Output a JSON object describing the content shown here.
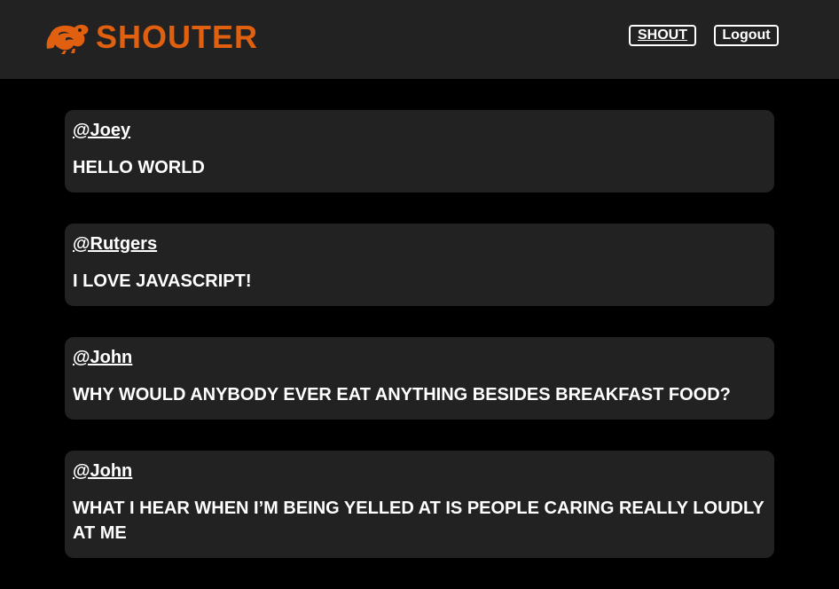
{
  "header": {
    "brand": "SHOUTER",
    "brand_color": "#e0600f",
    "logo_icon": "monkey-icon",
    "nav": {
      "shout_label": "SHOUT",
      "logout_label": "Logout"
    }
  },
  "posts": [
    {
      "user": "@Joey",
      "text": "HELLO WORLD"
    },
    {
      "user": "@Rutgers",
      "text": "I LOVE JAVASCRIPT!"
    },
    {
      "user": "@John",
      "text": "WHY WOULD ANYBODY EVER EAT ANYTHING BESIDES BREAKFAST FOOD?"
    },
    {
      "user": "@John",
      "text": "WHAT I HEAR WHEN I’M BEING YELLED AT IS PEOPLE CARING REALLY LOUDLY AT ME"
    }
  ]
}
